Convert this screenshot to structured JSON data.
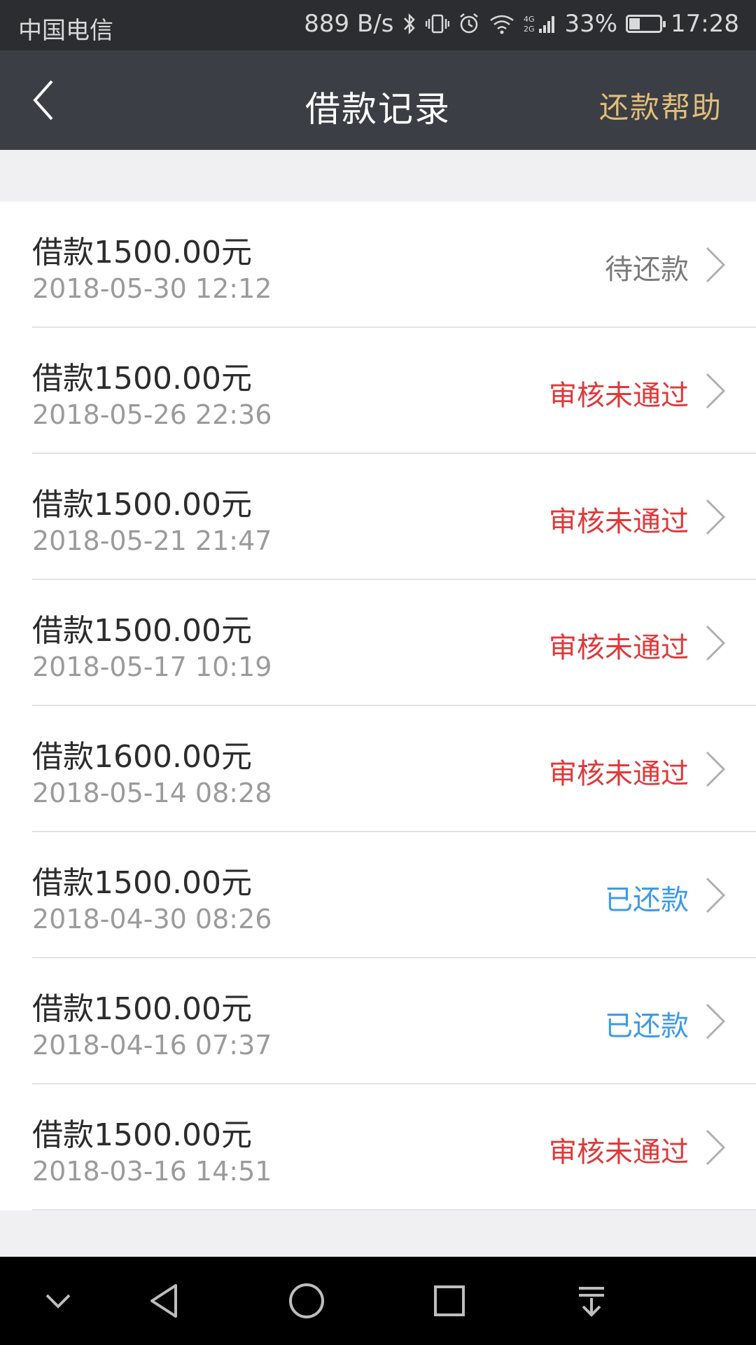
{
  "status_bar": {
    "carrier": "中国电信",
    "net_speed": "889 B/s",
    "network": "4G 2G",
    "battery": "33%",
    "battery_level": 0.33,
    "time": "17:28"
  },
  "header": {
    "title": "借款记录",
    "help_label": "还款帮助"
  },
  "records": [
    {
      "amount": "借款1500.00元",
      "time": "2018-05-30 12:12",
      "status": "待还款",
      "status_type": "pending"
    },
    {
      "amount": "借款1500.00元",
      "time": "2018-05-26 22:36",
      "status": "审核未通过",
      "status_type": "rejected"
    },
    {
      "amount": "借款1500.00元",
      "time": "2018-05-21 21:47",
      "status": "审核未通过",
      "status_type": "rejected"
    },
    {
      "amount": "借款1500.00元",
      "time": "2018-05-17 10:19",
      "status": "审核未通过",
      "status_type": "rejected"
    },
    {
      "amount": "借款1600.00元",
      "time": "2018-05-14 08:28",
      "status": "审核未通过",
      "status_type": "rejected"
    },
    {
      "amount": "借款1500.00元",
      "time": "2018-04-30 08:26",
      "status": "已还款",
      "status_type": "repaid"
    },
    {
      "amount": "借款1500.00元",
      "time": "2018-04-16 07:37",
      "status": "已还款",
      "status_type": "repaid"
    },
    {
      "amount": "借款1500.00元",
      "time": "2018-03-16 14:51",
      "status": "审核未通过",
      "status_type": "rejected"
    }
  ],
  "colors": {
    "pending": "#7a7a7a",
    "rejected": "#e0393a",
    "repaid": "#3d9ae8",
    "help_accent": "#e2bd7a",
    "header_bg": "#3b3e44"
  },
  "nav_icons": [
    "chevron-down-icon",
    "back-triangle-icon",
    "home-circle-icon",
    "recents-square-icon",
    "notification-pull-icon"
  ]
}
